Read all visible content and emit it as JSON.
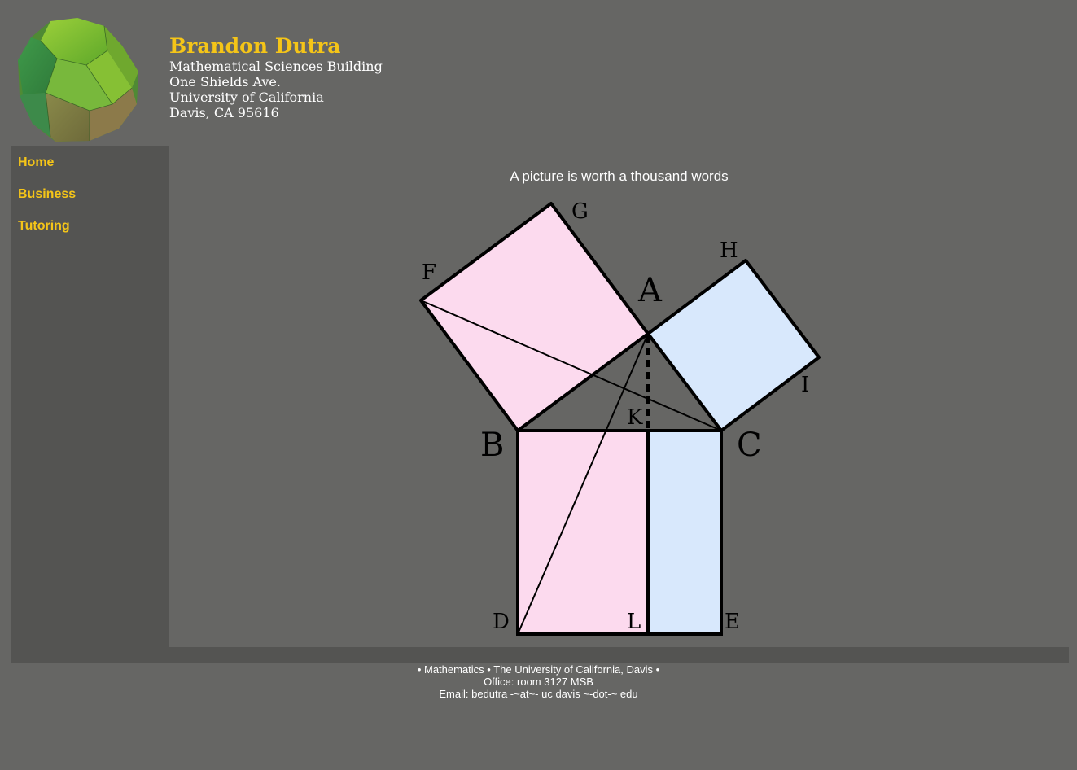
{
  "header": {
    "name": "Brandon Dutra",
    "address": [
      "Mathematical Sciences Building",
      "One Shields Ave.",
      "University of California",
      "Davis, CA 95616"
    ]
  },
  "logo": {
    "icon": "truncated-octahedron-polyhedron",
    "color": "#5fae3a"
  },
  "nav": {
    "items": [
      {
        "label": "Home"
      },
      {
        "label": "Business"
      },
      {
        "label": "Tutoring"
      }
    ],
    "link_color": "#f5c518"
  },
  "main": {
    "caption": "A picture is worth a thousand words",
    "figure": {
      "labels": {
        "A": "A",
        "B": "B",
        "C": "C",
        "D": "D",
        "E": "E",
        "F": "F",
        "G": "G",
        "H": "H",
        "I": "I",
        "K": "K",
        "L": "L"
      },
      "colors": {
        "pink": "#fcdaee",
        "blue": "#d8e8fc"
      }
    }
  },
  "footer": {
    "line1": "• Mathematics • The University of California, Davis •",
    "line2": "Office: room 3127 MSB",
    "line3": "Email: bedutra -~at~- uc davis ~-dot-~ edu"
  }
}
